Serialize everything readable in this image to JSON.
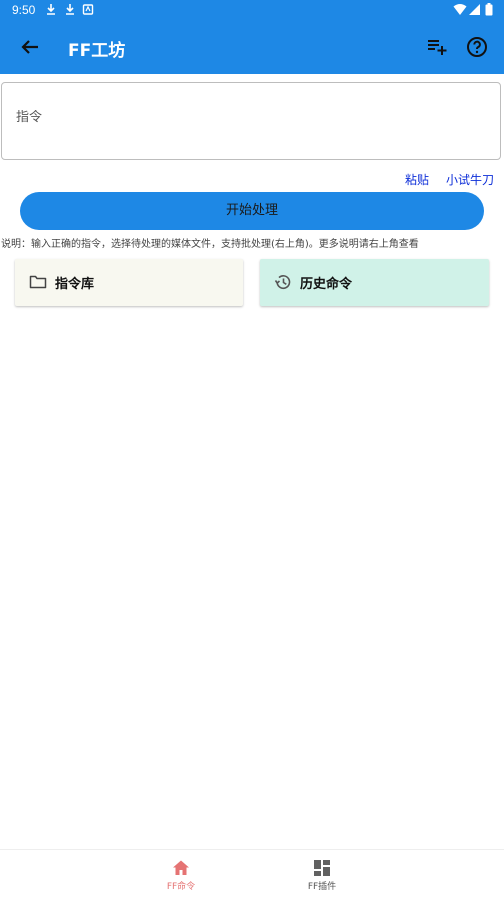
{
  "status_bar": {
    "time": "9:50"
  },
  "app_bar": {
    "title": "FF工坊",
    "back_icon": "arrow-back-icon",
    "actions": [
      "playlist-add-icon",
      "help-circle-icon"
    ]
  },
  "command_input": {
    "placeholder": "指令",
    "value": ""
  },
  "links": {
    "paste": "粘贴",
    "try": "小试牛刀"
  },
  "start_button": {
    "label": "开始处理"
  },
  "hint": "说明：输入正确的指令，选择待处理的媒体文件，支持批处理(右上角)。更多说明请右上角查看",
  "cards": {
    "library": {
      "label": "指令库",
      "icon": "folder-icon"
    },
    "history": {
      "label": "历史命令",
      "icon": "history-icon"
    }
  },
  "bottom_nav": {
    "tabs": [
      {
        "label": "FF命令",
        "icon": "home-icon",
        "active": true
      },
      {
        "label": "FF插件",
        "icon": "dashboard-icon",
        "active": false
      }
    ]
  },
  "colors": {
    "primary": "#1e88e5",
    "active_tab": "#e57373",
    "link": "#0d2ed8"
  }
}
